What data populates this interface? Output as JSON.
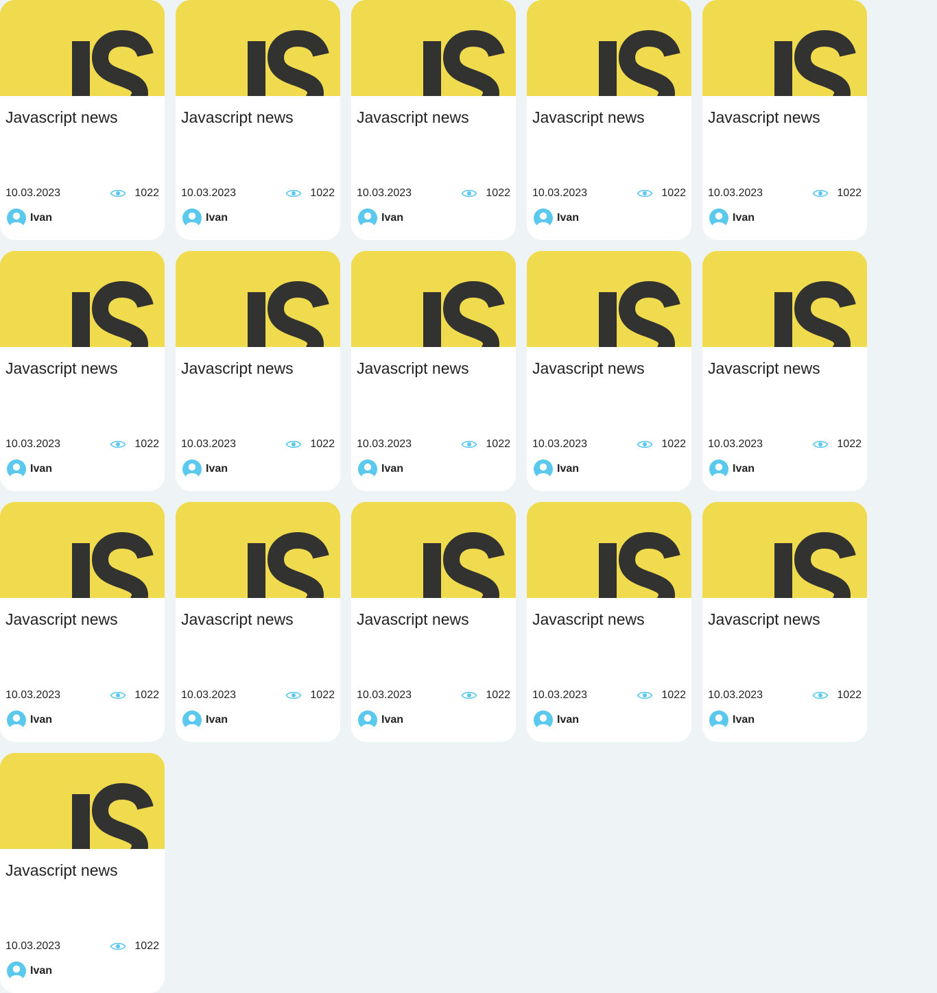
{
  "colors": {
    "page_background": "#eef3f6",
    "card_background": "#ffffff",
    "js_yellow": "#f0db4f",
    "js_dark": "#323330",
    "accent_blue": "#5bc8ee"
  },
  "cards": [
    {
      "image_logo": "JS",
      "title": "Javascript news",
      "date": "10.03.2023",
      "views": "1022",
      "views_icon": "eye-icon",
      "author_icon": "user-avatar-icon",
      "author": "Ivan"
    },
    {
      "image_logo": "JS",
      "title": "Javascript news",
      "date": "10.03.2023",
      "views": "1022",
      "views_icon": "eye-icon",
      "author_icon": "user-avatar-icon",
      "author": "Ivan"
    },
    {
      "image_logo": "JS",
      "title": "Javascript news",
      "date": "10.03.2023",
      "views": "1022",
      "views_icon": "eye-icon",
      "author_icon": "user-avatar-icon",
      "author": "Ivan"
    },
    {
      "image_logo": "JS",
      "title": "Javascript news",
      "date": "10.03.2023",
      "views": "1022",
      "views_icon": "eye-icon",
      "author_icon": "user-avatar-icon",
      "author": "Ivan"
    },
    {
      "image_logo": "JS",
      "title": "Javascript news",
      "date": "10.03.2023",
      "views": "1022",
      "views_icon": "eye-icon",
      "author_icon": "user-avatar-icon",
      "author": "Ivan"
    },
    {
      "image_logo": "JS",
      "title": "Javascript news",
      "date": "10.03.2023",
      "views": "1022",
      "views_icon": "eye-icon",
      "author_icon": "user-avatar-icon",
      "author": "Ivan"
    },
    {
      "image_logo": "JS",
      "title": "Javascript news",
      "date": "10.03.2023",
      "views": "1022",
      "views_icon": "eye-icon",
      "author_icon": "user-avatar-icon",
      "author": "Ivan"
    },
    {
      "image_logo": "JS",
      "title": "Javascript news",
      "date": "10.03.2023",
      "views": "1022",
      "views_icon": "eye-icon",
      "author_icon": "user-avatar-icon",
      "author": "Ivan"
    },
    {
      "image_logo": "JS",
      "title": "Javascript news",
      "date": "10.03.2023",
      "views": "1022",
      "views_icon": "eye-icon",
      "author_icon": "user-avatar-icon",
      "author": "Ivan"
    },
    {
      "image_logo": "JS",
      "title": "Javascript news",
      "date": "10.03.2023",
      "views": "1022",
      "views_icon": "eye-icon",
      "author_icon": "user-avatar-icon",
      "author": "Ivan"
    },
    {
      "image_logo": "JS",
      "title": "Javascript news",
      "date": "10.03.2023",
      "views": "1022",
      "views_icon": "eye-icon",
      "author_icon": "user-avatar-icon",
      "author": "Ivan"
    },
    {
      "image_logo": "JS",
      "title": "Javascript news",
      "date": "10.03.2023",
      "views": "1022",
      "views_icon": "eye-icon",
      "author_icon": "user-avatar-icon",
      "author": "Ivan"
    },
    {
      "image_logo": "JS",
      "title": "Javascript news",
      "date": "10.03.2023",
      "views": "1022",
      "views_icon": "eye-icon",
      "author_icon": "user-avatar-icon",
      "author": "Ivan"
    },
    {
      "image_logo": "JS",
      "title": "Javascript news",
      "date": "10.03.2023",
      "views": "1022",
      "views_icon": "eye-icon",
      "author_icon": "user-avatar-icon",
      "author": "Ivan"
    },
    {
      "image_logo": "JS",
      "title": "Javascript news",
      "date": "10.03.2023",
      "views": "1022",
      "views_icon": "eye-icon",
      "author_icon": "user-avatar-icon",
      "author": "Ivan"
    },
    {
      "image_logo": "JS",
      "title": "Javascript news",
      "date": "10.03.2023",
      "views": "1022",
      "views_icon": "eye-icon",
      "author_icon": "user-avatar-icon",
      "author": "Ivan"
    }
  ]
}
